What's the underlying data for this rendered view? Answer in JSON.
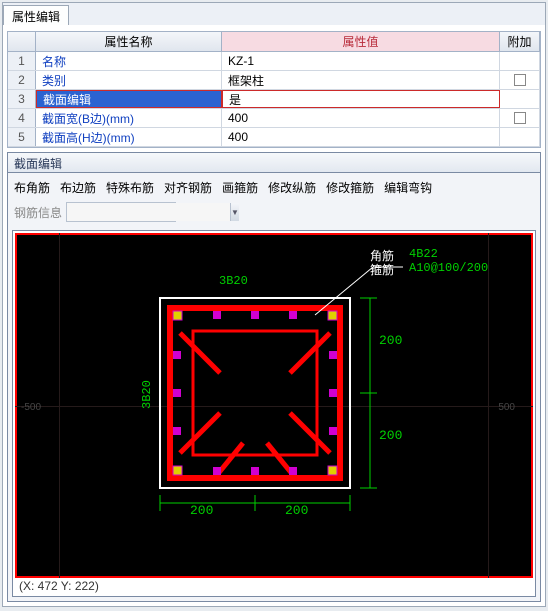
{
  "tab": {
    "label": "属性编辑"
  },
  "grid": {
    "headers": {
      "name": "属性名称",
      "value": "属性值",
      "extra": "附加"
    },
    "rows": [
      {
        "n": "1",
        "name": "名称",
        "value": "KZ-1",
        "chk": false
      },
      {
        "n": "2",
        "name": "类别",
        "value": "框架柱",
        "chk": true
      },
      {
        "n": "3",
        "name": "截面编辑",
        "value": "是",
        "sel": true,
        "chk": false
      },
      {
        "n": "4",
        "name": "截面宽(B边)(mm)",
        "value": "400",
        "chk": true
      },
      {
        "n": "5",
        "name": "截面高(H边)(mm)",
        "value": "400",
        "chk": false
      }
    ]
  },
  "section": {
    "title": "截面编辑",
    "tools": [
      "布角筋",
      "布边筋",
      "特殊布筋",
      "对齐钢筋",
      "画箍筋",
      "修改纵筋",
      "修改箍筋",
      "编辑弯钩"
    ],
    "subbar_label": "钢筋信息",
    "combo_value": ""
  },
  "drawing": {
    "rebar_top": "3B20",
    "rebar_left": "3B20",
    "label1": "角筋",
    "label2": "箍筋",
    "label1_val": "4B22",
    "label2_val": "A10@100/200",
    "dims_h": [
      "200",
      "200"
    ],
    "dims_v": [
      "200",
      "200"
    ],
    "axes": [
      "-500",
      "500"
    ]
  },
  "status": "(X: 472 Y: 222)",
  "chart_data": {
    "type": "diagram",
    "column_section": {
      "shape": "rectangle",
      "B_mm": 400,
      "H_mm": 400,
      "corner_bars": "4B22",
      "edge_bars_top": "3B20",
      "edge_bars_left": "3B20",
      "stirrups": "A10@100/200",
      "dim_segments_h_mm": [
        200,
        200
      ],
      "dim_segments_v_mm": [
        200,
        200
      ]
    }
  }
}
